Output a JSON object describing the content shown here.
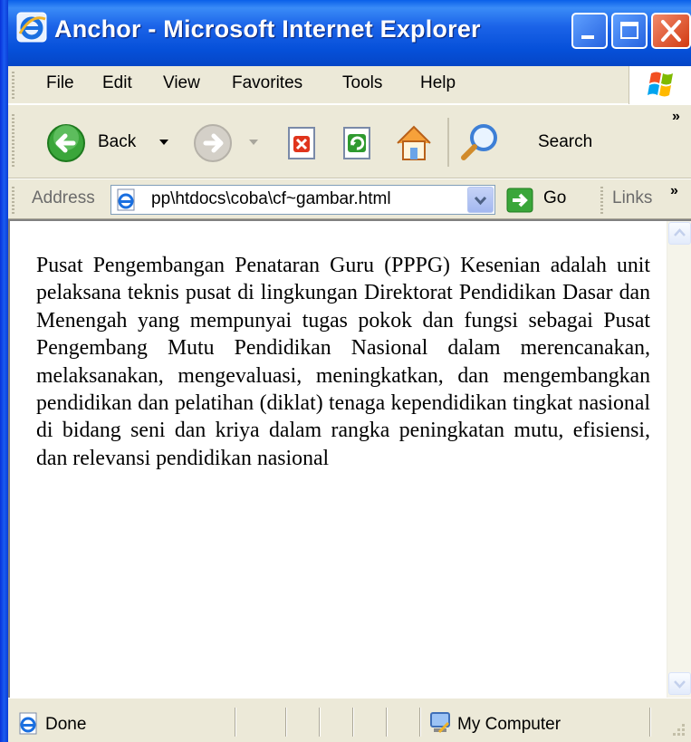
{
  "window": {
    "title": "Anchor - Microsoft Internet Explorer",
    "app_icon": "ie-icon",
    "controls": [
      "minimize-icon",
      "maximize-icon",
      "close-icon"
    ]
  },
  "menu": {
    "items": [
      "File",
      "Edit",
      "View",
      "Favorites",
      "Tools",
      "Help"
    ]
  },
  "toolbar": {
    "back_label": "Back",
    "search_label": "Search",
    "overflow_label": "»"
  },
  "address": {
    "label": "Address",
    "value": "pp\\htdocs\\coba\\cf~gambar.html",
    "go_label": "Go",
    "links_label": "Links",
    "links_overflow": "»"
  },
  "content": {
    "paragraph": "Pusat Pengembangan Penataran Guru (PPPG) Kesenian adalah unit pelaksana teknis pusat di lingkungan Direktorat Pendidikan Dasar dan Menengah yang mempunyai tugas pokok dan fungsi sebagai Pusat Pengembang Mutu Pendidikan Nasional dalam merencanakan, melaksanakan, mengevaluasi, meningkatkan, dan mengembangkan pendidikan dan pelatihan (diklat) tenaga kependidikan tingkat nasional di bidang seni dan kriya dalam rangka peningkatan mutu, efisiensi, dan relevansi pendidikan nasional"
  },
  "status": {
    "text": "Done",
    "zone": "My Computer"
  },
  "colors": {
    "titlebar": "#0a5fe9",
    "chrome": "#ece9d8",
    "close_button": "#d23b12"
  }
}
